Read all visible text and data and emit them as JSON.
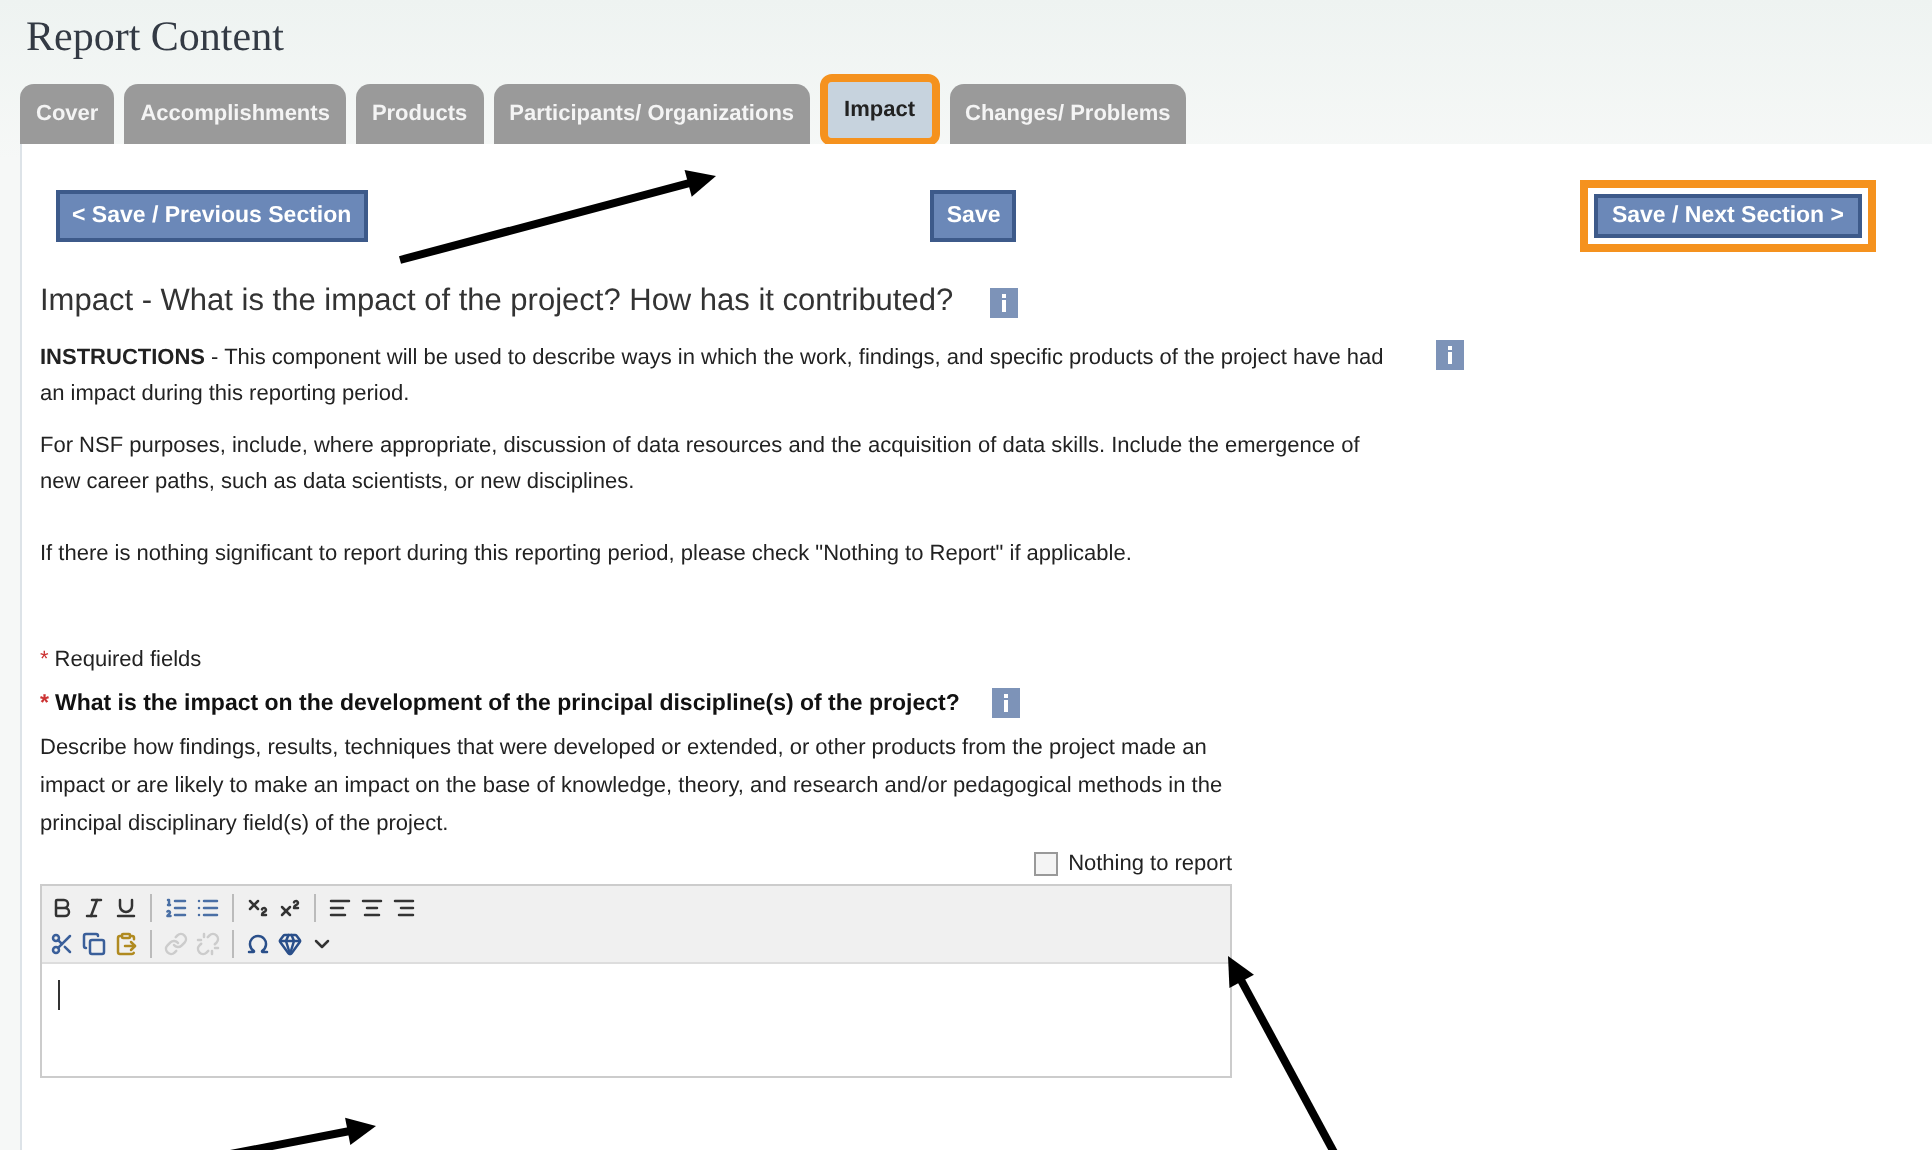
{
  "page_title": "Report Content",
  "tabs": [
    {
      "label": "Cover",
      "selected": false
    },
    {
      "label": "Accomplishments",
      "selected": false
    },
    {
      "label": "Products",
      "selected": false
    },
    {
      "label": "Participants/ Organizations",
      "selected": false
    },
    {
      "label": "Impact",
      "selected": true
    },
    {
      "label": "Changes/ Problems",
      "selected": false
    }
  ],
  "nav_buttons": [
    {
      "label": "< Save / Previous Section",
      "highlighted": false
    },
    {
      "label": "Save",
      "highlighted": false
    },
    {
      "label": "Save / Next Section >",
      "highlighted": true
    }
  ],
  "section_heading": "Impact - What is the impact of the project? How has it contributed?",
  "instructions": [
    "**INSTRUCTIONS** - This component will be used to describe ways in which the work, findings, and specific products of the project have had an impact during this reporting period.",
    "For NSF purposes, include, where appropriate, discussion of data resources and the acquisition of data skills. Include the emergence of new career paths, such as data scientists, or new disciplines.",
    "If there is nothing significant to report during this reporting period, please check \"Nothing to Report\" if applicable."
  ],
  "required_mark": "*",
  "required_note": "Required fields",
  "question": {
    "label": "What is the impact on the development of the principal discipline(s) of the project?",
    "description": "Describe how findings, results, techniques that were developed or extended, or other products from the project made an impact or are likely to make an impact on the base of knowledge, theory, and research and/or pedagogical methods in the principal disciplinary field(s) of the project.",
    "nothing_to_report": {
      "label": "Nothing to report",
      "checked": false
    }
  }
}
